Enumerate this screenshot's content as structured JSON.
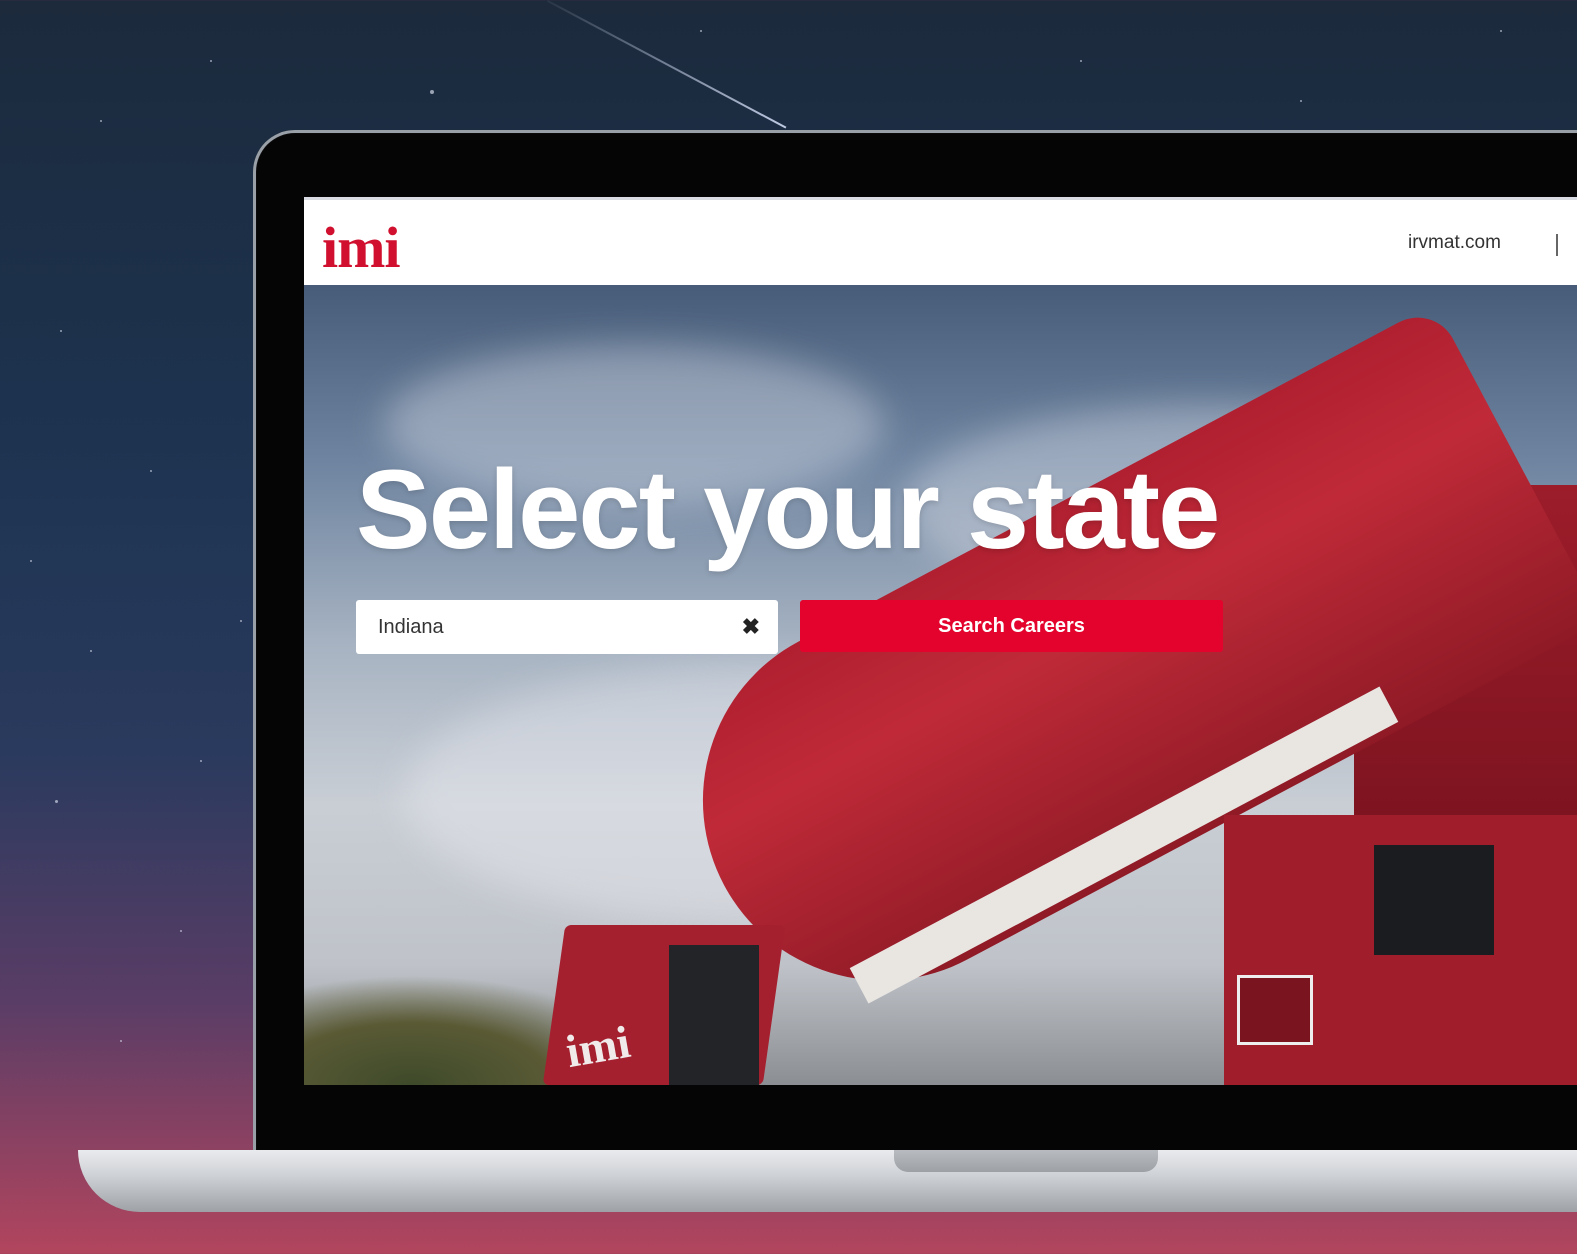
{
  "site": {
    "logo_text": "imi",
    "nav_link": "irvmat.com"
  },
  "hero": {
    "headline": "Select your state",
    "state_input_value": "Indiana",
    "search_button_label": "Search Careers",
    "truck_logo_text": "imi"
  },
  "colors": {
    "brand_red": "#e4032c",
    "logo_red": "#d0102e"
  },
  "icons": {
    "clear": "close-icon"
  }
}
